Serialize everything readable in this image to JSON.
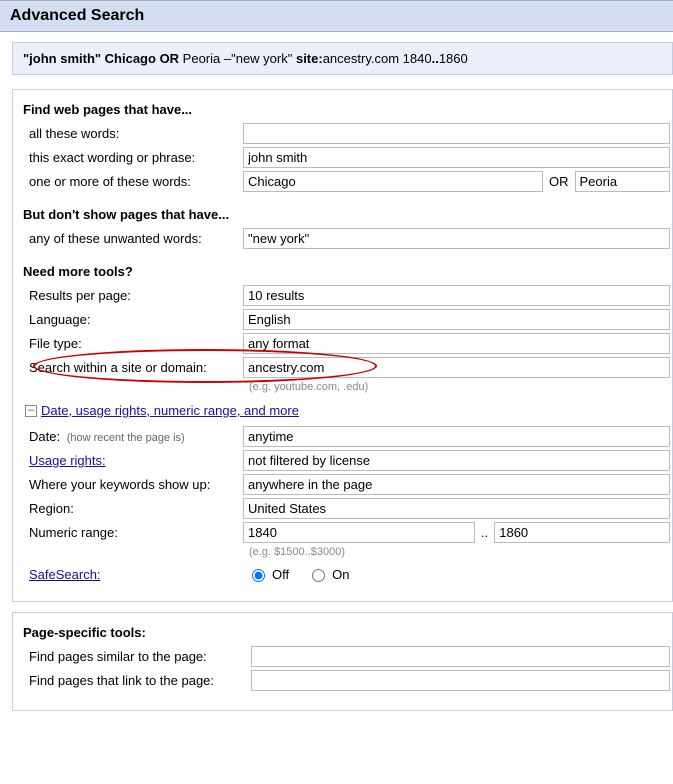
{
  "header": {
    "title": "Advanced Search"
  },
  "query": {
    "q1": "\"john smith\" Chicago ",
    "or": "OR",
    "q2": " Peoria –\"new york\" ",
    "site_label": "site:",
    "site_val": "ancestry.com",
    "q3": " 1840",
    "dots": "..",
    "q4": "1860"
  },
  "find": {
    "heading": "Find web pages that have...",
    "all_label": "all these words:",
    "all_value": "",
    "exact_label": "this exact wording or phrase:",
    "exact_value": "john smith",
    "any_label": "one or more of these words:",
    "any_v1": "Chicago",
    "or_label": "OR",
    "any_v2": "Peoria"
  },
  "exclude": {
    "heading": "But don't show pages that have...",
    "unwanted_label": "any of these unwanted words:",
    "unwanted_value": "\"new york\""
  },
  "tools": {
    "heading": "Need more tools?",
    "results_label": "Results per page:",
    "results_value": "10 results",
    "language_label": "Language:",
    "language_value": "English",
    "filetype_label": "File type:",
    "filetype_value": "any format",
    "domain_label": "Search within a site or domain:",
    "domain_value": "ancestry.com",
    "domain_hint": "(e.g. youtube.com, .edu)"
  },
  "more": {
    "toggle_label": "Date, usage rights, numeric range, and more",
    "date_label": "Date:",
    "date_desc": "(how recent the page is)",
    "date_value": "anytime",
    "usage_label": "Usage rights:",
    "usage_value": "not filtered by license",
    "where_label": "Where your keywords show up:",
    "where_value": "anywhere in the page",
    "region_label": "Region:",
    "region_value": "United States",
    "range_label": "Numeric range:",
    "range_v1": "1840",
    "range_sep": "..",
    "range_v2": "1860",
    "range_hint": "(e.g. $1500..$3000)",
    "safe_label": "SafeSearch:",
    "safe_off": "Off",
    "safe_on": "On"
  },
  "pgtools": {
    "heading": "Page-specific tools:",
    "similar_label": "Find pages similar to the page:",
    "links_label": "Find pages that link to the page:"
  }
}
